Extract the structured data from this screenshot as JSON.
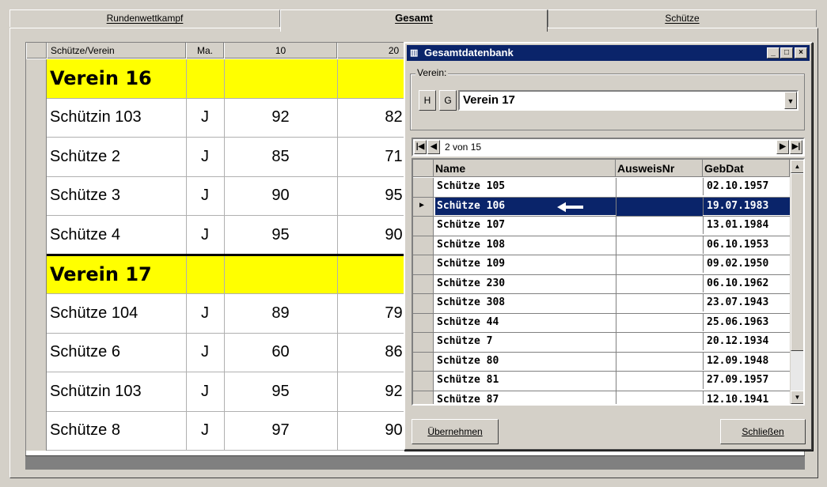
{
  "tabs": [
    {
      "label": "Rundenwettkampf"
    },
    {
      "label": "Gesamt"
    },
    {
      "label": "Schütze"
    }
  ],
  "grid": {
    "headers": [
      "Schütze/Verein",
      "Ma.",
      "10",
      "20"
    ],
    "rows": [
      {
        "type": "club",
        "name": "Verein 16"
      },
      {
        "type": "shooter",
        "name": "Schützin 103",
        "ma": "J",
        "v10": "92",
        "v20": "82"
      },
      {
        "type": "shooter",
        "name": "Schütze 2",
        "ma": "J",
        "v10": "85",
        "v20": "71"
      },
      {
        "type": "shooter",
        "name": "Schütze 3",
        "ma": "J",
        "v10": "90",
        "v20": "95"
      },
      {
        "type": "shooter",
        "name": "Schütze 4",
        "ma": "J",
        "v10": "95",
        "v20": "90"
      },
      {
        "type": "club",
        "name": "Verein 17"
      },
      {
        "type": "shooter",
        "name": "Schütze 104",
        "ma": "J",
        "v10": "89",
        "v20": "79"
      },
      {
        "type": "shooter",
        "name": "Schütze 6",
        "ma": "J",
        "v10": "60",
        "v20": "86"
      },
      {
        "type": "shooter",
        "name": "Schützin 103",
        "ma": "J",
        "v10": "95",
        "v20": "92"
      },
      {
        "type": "shooter",
        "name": "Schütze 8",
        "ma": "J",
        "v10": "97",
        "v20": "90"
      }
    ]
  },
  "dialog": {
    "title": "Gesamtdatenbank",
    "title_buttons": {
      "minimize": "_",
      "maximize": "□",
      "close": "×"
    },
    "verein_label": "Verein:",
    "btn_h": "H",
    "btn_g": "G",
    "verein_value": "Verein 17",
    "navigator": {
      "text": "2 von 15"
    },
    "list_headers": {
      "name": "Name",
      "ausweis": "AusweisNr",
      "gebdat": "GebDat"
    },
    "list_rows": [
      {
        "name": "Schütze 105",
        "gebdat": "02.10.1957"
      },
      {
        "name": "Schütze 106",
        "gebdat": "19.07.1983",
        "selected": true
      },
      {
        "name": "Schütze 107",
        "gebdat": "13.01.1984"
      },
      {
        "name": "Schütze 108",
        "gebdat": "06.10.1953"
      },
      {
        "name": "Schütze 109",
        "gebdat": "09.02.1950"
      },
      {
        "name": "Schütze 230",
        "gebdat": "06.10.1962"
      },
      {
        "name": "Schütze 308",
        "gebdat": "23.07.1943"
      },
      {
        "name": "Schütze 44",
        "gebdat": "25.06.1963"
      },
      {
        "name": "Schütze 7",
        "gebdat": "20.12.1934"
      },
      {
        "name": "Schütze 80",
        "gebdat": "12.09.1948"
      },
      {
        "name": "Schütze 81",
        "gebdat": "27.09.1957"
      },
      {
        "name": "Schütze 87",
        "gebdat": "12.10.1941"
      }
    ],
    "btn_uebernehmen": "Übernehmen",
    "btn_schliessen": "Schließen"
  },
  "colors": {
    "club_band": "#ffff00",
    "selection": "#0a246a",
    "titlebar": "#0a246a"
  }
}
